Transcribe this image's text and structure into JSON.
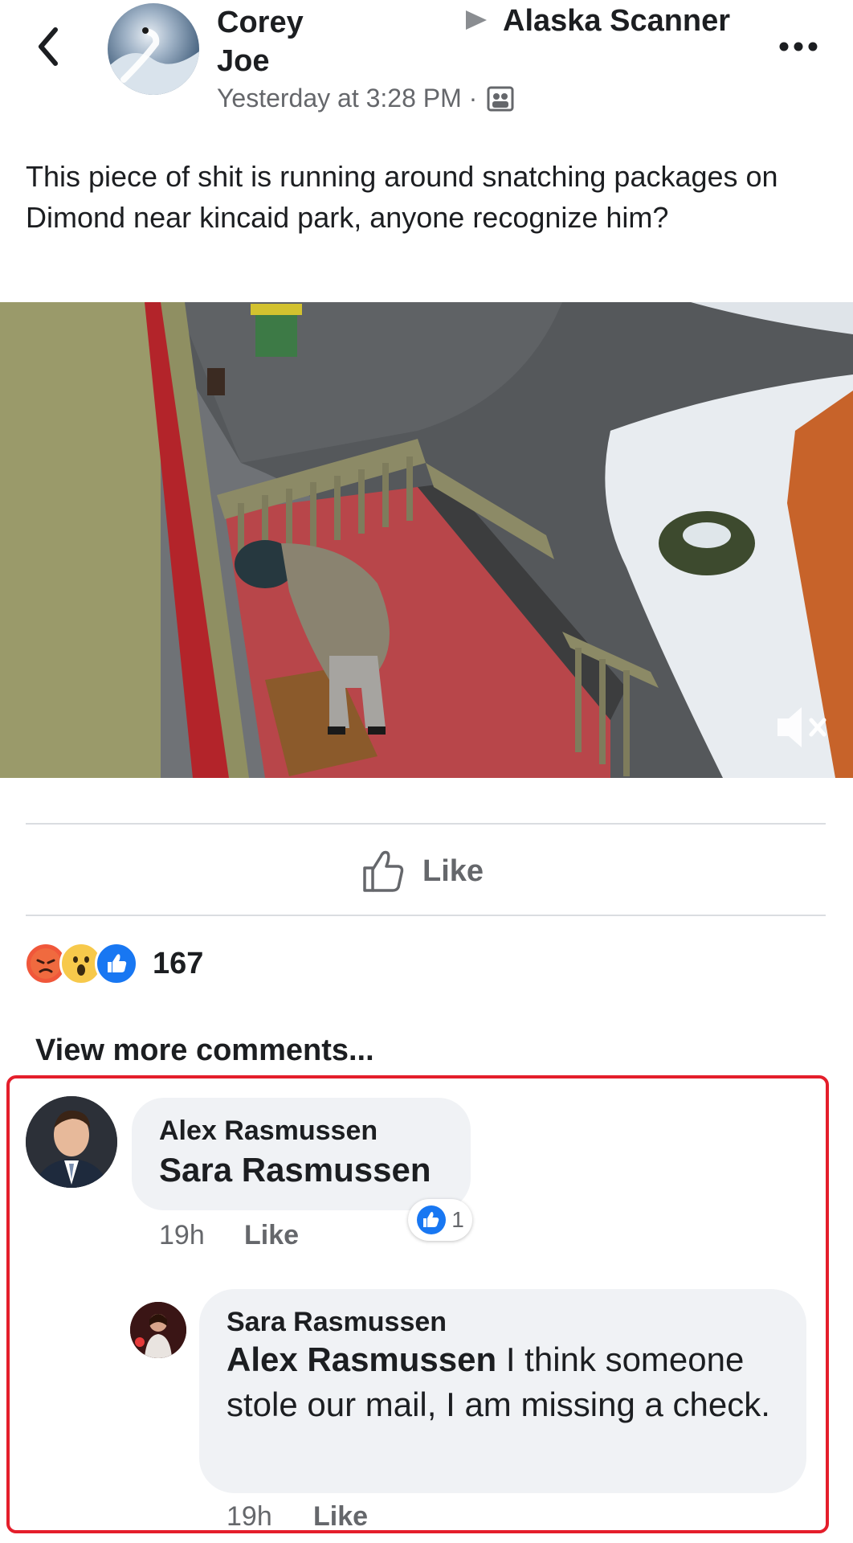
{
  "header": {
    "author": "Corey Joe",
    "group": "Alaska Scanner",
    "timestamp": "Yesterday at 3:28 PM ·"
  },
  "post": {
    "text": "This piece of shit is running around snatching packages on Dimond near kincaid park, anyone recognize him?"
  },
  "actions": {
    "like_label": "Like"
  },
  "reactions": {
    "icons": [
      "angry-reaction-icon",
      "wow-reaction-icon",
      "like-reaction-icon"
    ],
    "count": "167"
  },
  "comments": {
    "view_more": "View more comments...",
    "items": [
      {
        "author": "Alex Rasmussen",
        "text": "Sara Rasmussen",
        "time": "19h",
        "like_label": "Like",
        "reaction_count": "1"
      },
      {
        "author": "Sara Rasmussen",
        "mention": "Alex Rasmussen",
        "text": " I think someone stole our mail, I am missing a check.",
        "time": "19h",
        "like_label": "Like"
      }
    ]
  },
  "colors": {
    "highlight": "#e41e2b",
    "secondary_text": "#65676b",
    "like_blue": "#1877f2",
    "bubble": "#f0f2f5"
  }
}
